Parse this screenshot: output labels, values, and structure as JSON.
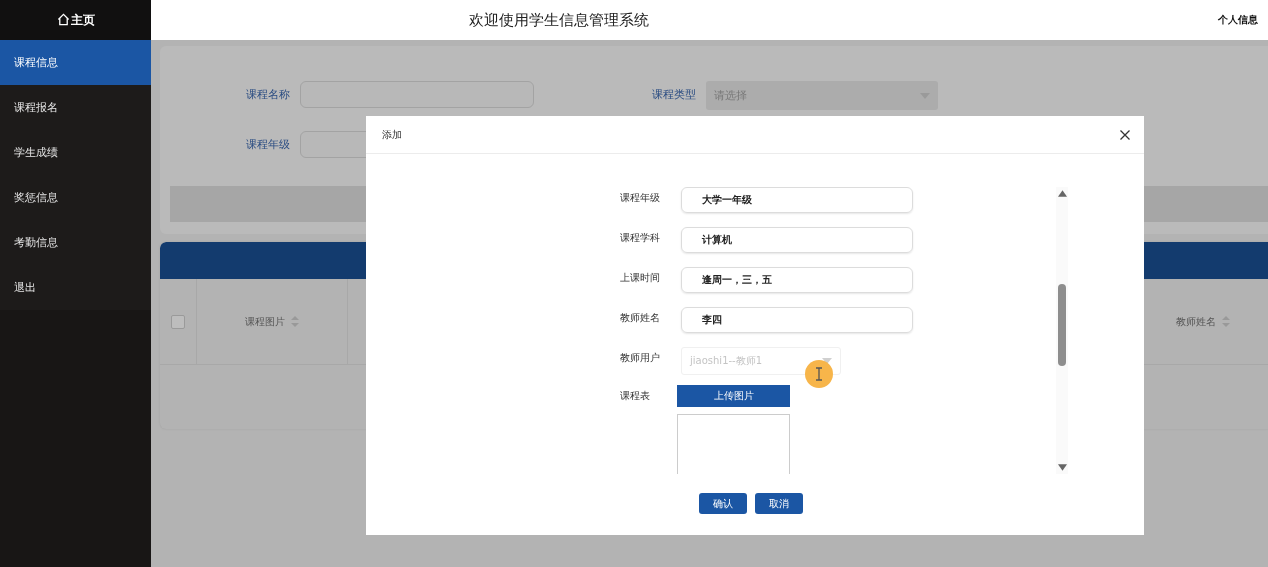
{
  "header": {
    "brand": "主页",
    "title": "欢迎使用学生信息管理系统",
    "profile_link": "个人信息"
  },
  "sidebar": {
    "items": [
      {
        "label": "课程信息",
        "selected": true
      },
      {
        "label": "课程报名",
        "selected": false
      },
      {
        "label": "学生成绩",
        "selected": false
      },
      {
        "label": "奖惩信息",
        "selected": false
      },
      {
        "label": "考勤信息",
        "selected": false
      },
      {
        "label": "退出",
        "selected": false
      }
    ]
  },
  "search": {
    "rows": [
      {
        "fields": [
          {
            "label": "课程名称",
            "kind": "input"
          },
          {
            "label": "课程类型",
            "kind": "select",
            "placeholder": "请选择"
          }
        ]
      },
      {
        "fields": [
          {
            "label": "课程年级",
            "kind": "input"
          }
        ]
      }
    ]
  },
  "table": {
    "select_all_checked": false,
    "columns": [
      {
        "label": "课程图片"
      },
      {
        "label": "教师姓名"
      }
    ]
  },
  "dialog": {
    "title": "添加",
    "fields": [
      {
        "label": "课程年级",
        "kind": "text",
        "value": "大学一年级",
        "disabled": false
      },
      {
        "label": "课程学科",
        "kind": "text",
        "value": "计算机",
        "disabled": false
      },
      {
        "label": "上课时间",
        "kind": "text",
        "value": "逢周一，三，五",
        "disabled": false
      },
      {
        "label": "教师姓名",
        "kind": "text",
        "value": "李四",
        "disabled": false
      },
      {
        "label": "教师用户",
        "kind": "select",
        "value": "jiaoshi1--教师1",
        "disabled": true
      },
      {
        "label": "课程表",
        "kind": "upload",
        "button": "上传图片",
        "disabled": false
      }
    ],
    "buttons": [
      {
        "label": "确认"
      },
      {
        "label": "取消"
      }
    ]
  }
}
